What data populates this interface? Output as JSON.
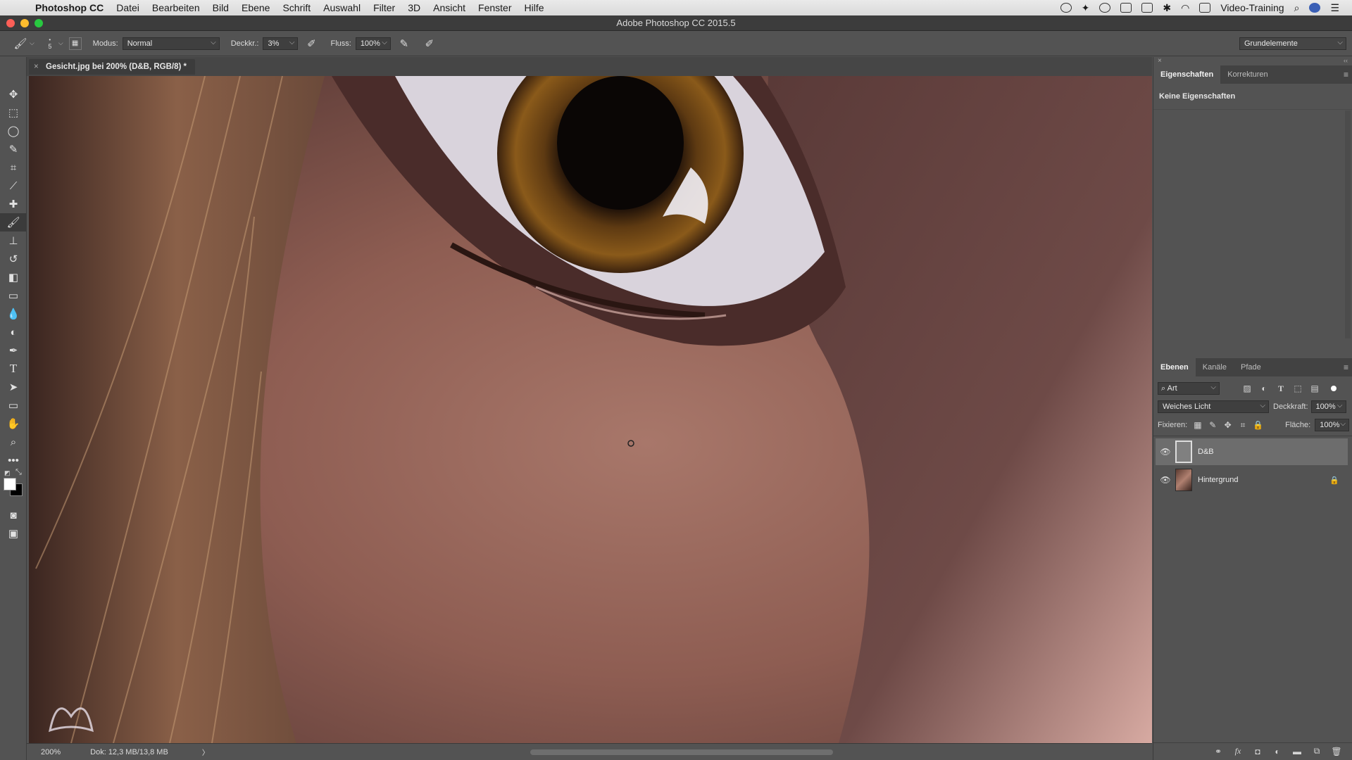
{
  "menubar": {
    "app_name": "Photoshop CC",
    "items": [
      "Datei",
      "Bearbeiten",
      "Bild",
      "Ebene",
      "Schrift",
      "Auswahl",
      "Filter",
      "3D",
      "Ansicht",
      "Fenster",
      "Hilfe"
    ],
    "user": "Video-Training"
  },
  "window": {
    "title": "Adobe Photoshop CC 2015.5"
  },
  "options": {
    "brush_size": "5",
    "mode_label": "Modus:",
    "mode_value": "Normal",
    "opacity_label": "Deckkr.:",
    "opacity_value": "3%",
    "flow_label": "Fluss:",
    "flow_value": "100%",
    "workspace": "Grundelemente"
  },
  "document": {
    "tab_title": "Gesicht.jpg bei 200% (D&B, RGB/8) *"
  },
  "status": {
    "zoom": "200%",
    "doc_size": "Dok: 12,3 MB/13,8 MB"
  },
  "properties": {
    "tabs": [
      "Eigenschaften",
      "Korrekturen"
    ],
    "empty_text": "Keine Eigenschaften"
  },
  "layers_panel": {
    "tabs": [
      "Ebenen",
      "Kanäle",
      "Pfade"
    ],
    "filter_kind": "Art",
    "blend_mode": "Weiches Licht",
    "opacity_label": "Deckkraft:",
    "opacity_value": "100%",
    "lock_label": "Fixieren:",
    "fill_label": "Fläche:",
    "fill_value": "100%",
    "layers": [
      {
        "name": "D&B",
        "selected": true,
        "visible": true
      },
      {
        "name": "Hintergrund",
        "selected": false,
        "visible": true,
        "locked": true
      }
    ]
  },
  "colors": {
    "foreground": "#ffffff",
    "background": "#000000",
    "accent": "#6d6d6d"
  }
}
